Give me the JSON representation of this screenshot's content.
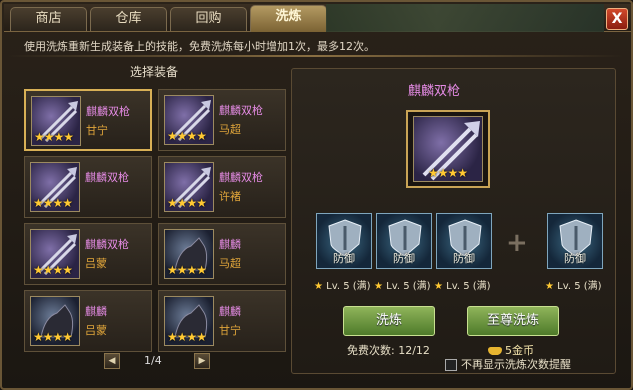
{
  "tabs": [
    {
      "label": "商店"
    },
    {
      "label": "仓库"
    },
    {
      "label": "回购"
    },
    {
      "label": "洗炼"
    }
  ],
  "close_label": "X",
  "hint": "使用洗炼重新生成装备上的技能，免费洗炼每小时增加1次，最多12次。",
  "left": {
    "title": "选择装备",
    "items": [
      {
        "name": "麒麟双枪",
        "owner": "甘宁",
        "stars": "★★★★"
      },
      {
        "name": "麒麟双枪",
        "owner": "马超",
        "stars": "★★★★"
      },
      {
        "name": "麒麟双枪",
        "owner": "",
        "stars": "★★★★"
      },
      {
        "name": "麒麟双枪",
        "owner": "许褚",
        "stars": "★★★★"
      },
      {
        "name": "麒麟双枪",
        "owner": "吕蒙",
        "stars": "★★★★"
      },
      {
        "name": "麒麟",
        "owner": "马超",
        "stars": "★★★★"
      },
      {
        "name": "麒麟",
        "owner": "吕蒙",
        "stars": "★★★★"
      },
      {
        "name": "麒麟",
        "owner": "甘宁",
        "stars": "★★★★"
      }
    ],
    "page": "1/4",
    "prev_icon": "◀",
    "next_icon": "▶"
  },
  "right": {
    "title": "麒麟双枪",
    "main_stars": "★★★★",
    "skills": [
      {
        "label": "防御",
        "level": "Lv. 5 (满)"
      },
      {
        "label": "防御",
        "level": "Lv. 5 (满)"
      },
      {
        "label": "防御",
        "level": "Lv. 5 (满)"
      },
      {
        "label": "防御",
        "level": "Lv. 5 (满)"
      }
    ],
    "star": "★",
    "plus": "+",
    "refine_label": "洗炼",
    "supreme_label": "至尊洗炼",
    "free_count": "免费次数: 12/12",
    "cost": "5金币",
    "reminder": "不再显示洗炼次数提醒"
  }
}
